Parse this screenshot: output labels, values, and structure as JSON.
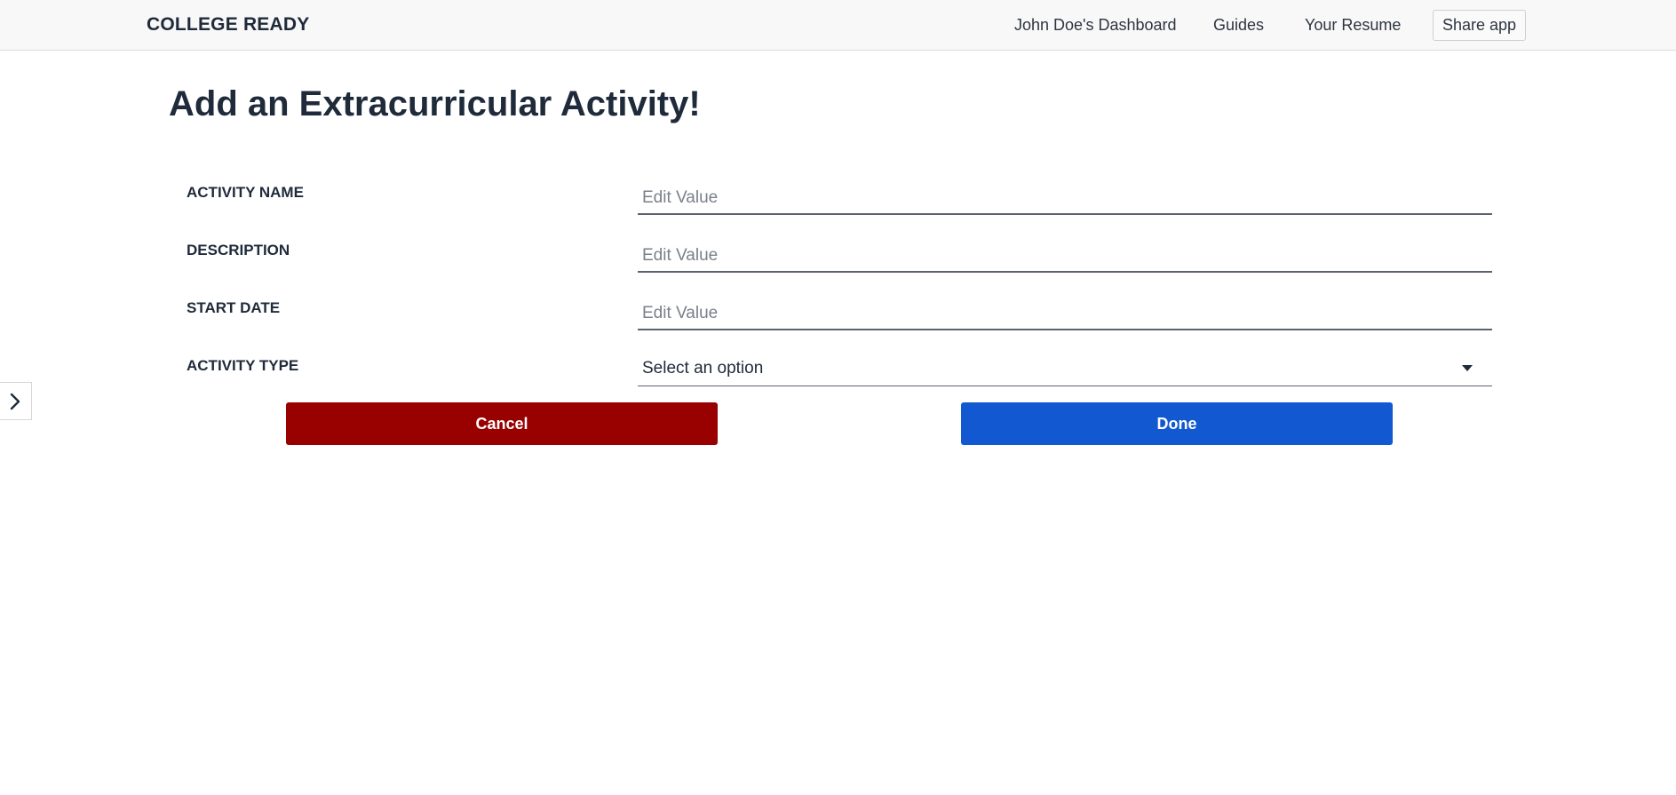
{
  "header": {
    "brand": "COLLEGE READY",
    "nav": {
      "dashboard": "John Doe's Dashboard",
      "guides": "Guides",
      "resume": "Your Resume"
    },
    "share_label": "Share app"
  },
  "sidebar_toggle_icon": "chevron-right-icon",
  "page": {
    "title": "Add an Extracurricular Activity!"
  },
  "form": {
    "activity_name": {
      "label": "ACTIVITY NAME",
      "placeholder": "Edit Value",
      "value": ""
    },
    "description": {
      "label": "DESCRIPTION",
      "placeholder": "Edit Value",
      "value": ""
    },
    "start_date": {
      "label": "START DATE",
      "placeholder": "Edit Value",
      "value": ""
    },
    "activity_type": {
      "label": "ACTIVITY TYPE",
      "selected": "Select an option"
    }
  },
  "buttons": {
    "cancel": "Cancel",
    "done": "Done"
  },
  "colors": {
    "cancel": "#990000",
    "done": "#1158d1",
    "header_bg": "#f8f8f8",
    "text": "#1f2a3a"
  }
}
